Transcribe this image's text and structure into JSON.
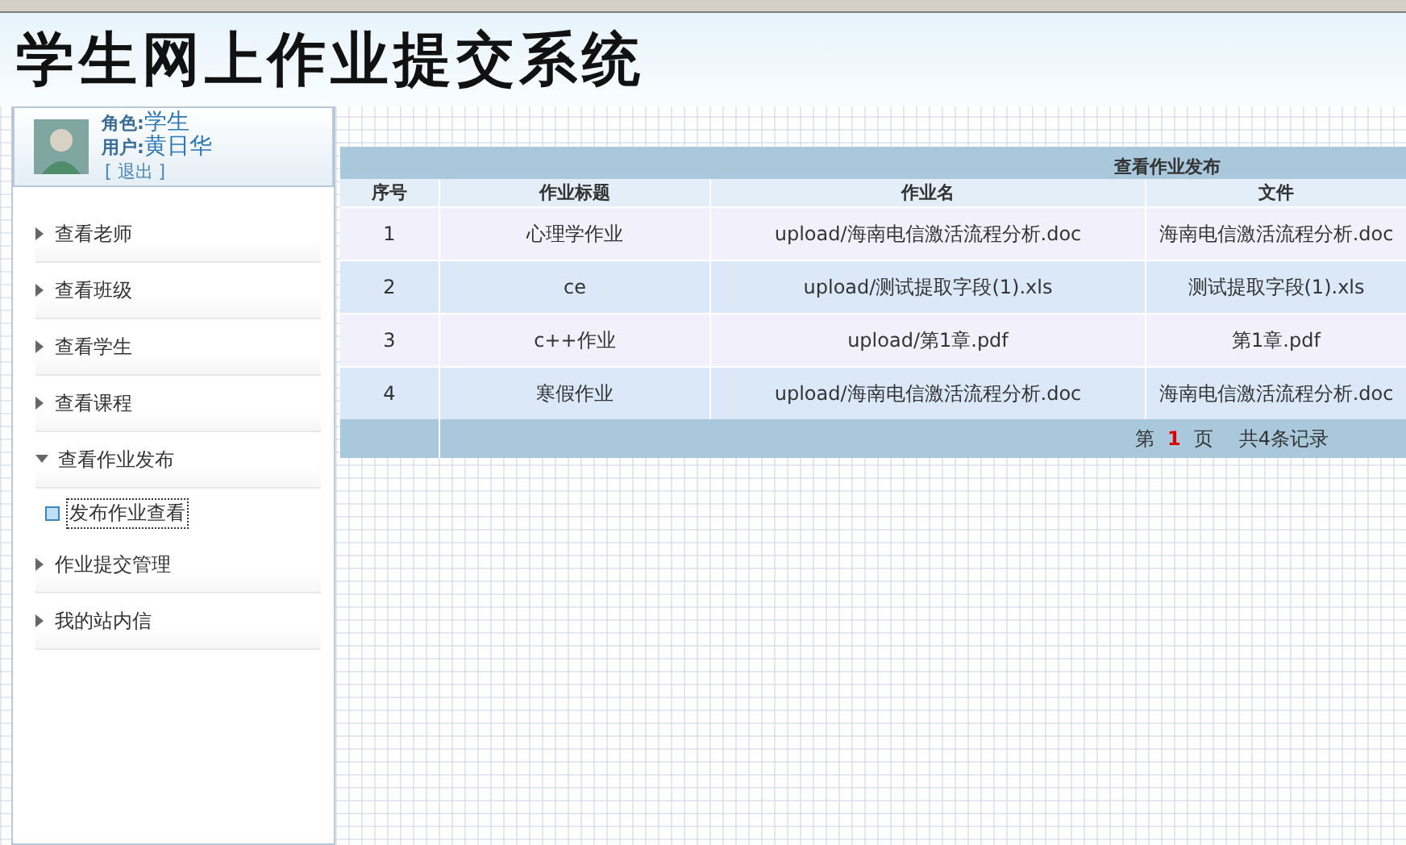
{
  "header": {
    "title": "学生网上作业提交系统"
  },
  "user": {
    "role_label": "角色:",
    "role": "学生",
    "user_label": "用户:",
    "name": "黄日华",
    "logout": "[ 退出 ]"
  },
  "menu": [
    {
      "label": "查看老师",
      "expanded": false
    },
    {
      "label": "查看班级",
      "expanded": false
    },
    {
      "label": "查看学生",
      "expanded": false
    },
    {
      "label": "查看课程",
      "expanded": false
    },
    {
      "label": "查看作业发布",
      "expanded": true,
      "children": [
        {
          "label": "发布作业查看",
          "selected": true
        }
      ]
    },
    {
      "label": "作业提交管理",
      "expanded": false
    },
    {
      "label": "我的站内信",
      "expanded": false
    }
  ],
  "table": {
    "title": "查看作业发布",
    "columns": [
      "序号",
      "作业标题",
      "作业名",
      "文件"
    ],
    "rows": [
      [
        "1",
        "心理学作业",
        "upload/海南电信激活流程分析.doc",
        "海南电信激活流程分析.doc"
      ],
      [
        "2",
        "ce",
        "upload/测试提取字段(1).xls",
        "测试提取字段(1).xls"
      ],
      [
        "3",
        "c++作业",
        "upload/第1章.pdf",
        "第1章.pdf"
      ],
      [
        "4",
        "寒假作业",
        "upload/海南电信激活流程分析.doc",
        "海南电信激活流程分析.doc"
      ]
    ],
    "pager": {
      "before": "第",
      "page": "1",
      "after": "页",
      "total": "共4条记录"
    }
  }
}
